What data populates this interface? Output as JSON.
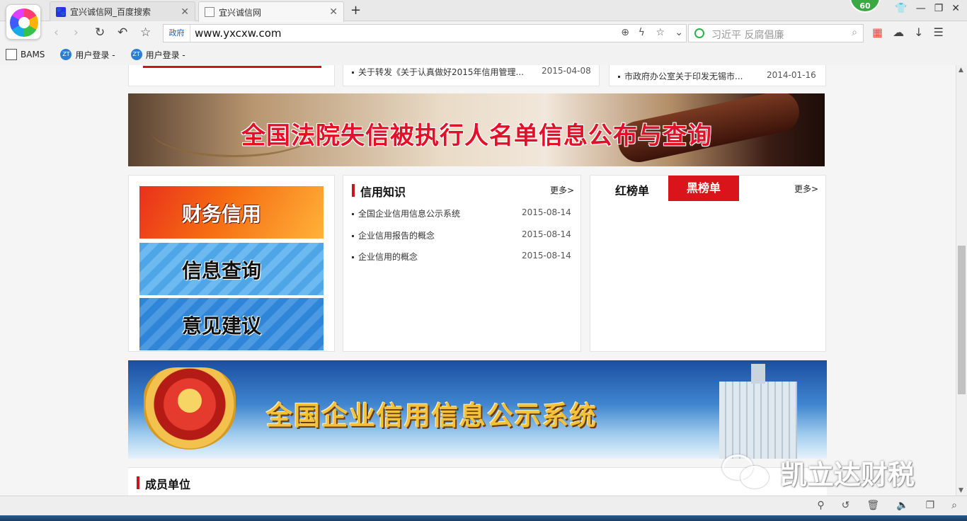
{
  "browser": {
    "badge": "60",
    "tabs": [
      {
        "label": "宜兴诚信网_百度搜索",
        "favicon": "baidu-icon",
        "active": false
      },
      {
        "label": "宜兴诚信网",
        "favicon": "page-icon",
        "active": true
      }
    ],
    "address": {
      "tag": "政府",
      "url": "www.yxcxw.com"
    },
    "search": {
      "placeholder": "习近平 反腐倡廉"
    },
    "bookmarks": [
      {
        "label": "BAMS",
        "icon": "bams-icon"
      },
      {
        "label": "用户登录 -",
        "icon": "zt-icon"
      },
      {
        "label": "用户登录 -",
        "icon": "zt-icon"
      }
    ]
  },
  "page": {
    "top_news": {
      "middle": {
        "title": "关于转发《关于认真做好2015年信用管理...",
        "date": "2015-04-08"
      },
      "right": {
        "title": "市政府办公室关于印发无锡市...",
        "date": "2014-01-16"
      }
    },
    "banner_court": {
      "title": "全国法院失信被执行人名单信息公布与查询"
    },
    "quick_links": [
      {
        "label": "财务信用"
      },
      {
        "label": "信息查询"
      },
      {
        "label": "意见建议"
      }
    ],
    "credit_knowledge": {
      "title": "信用知识",
      "more": "更多>",
      "items": [
        {
          "title": "全国企业信用信息公示系统",
          "date": "2015-08-14"
        },
        {
          "title": "企业信用报告的概念",
          "date": "2015-08-14"
        },
        {
          "title": "企业信用的概念",
          "date": "2015-08-14"
        }
      ]
    },
    "honor_list": {
      "tab_red": "红榜单",
      "tab_black": "黑榜单",
      "more": "更多>"
    },
    "banner_gsxt": {
      "title": "全国企业信用信息公示系统"
    },
    "members": {
      "title": "成员单位"
    },
    "watermark": "凯立达财税"
  },
  "colors": {
    "accent_red": "#d9141b",
    "section_bar": "#c8161d",
    "link_blue": "#1a5fb4"
  }
}
